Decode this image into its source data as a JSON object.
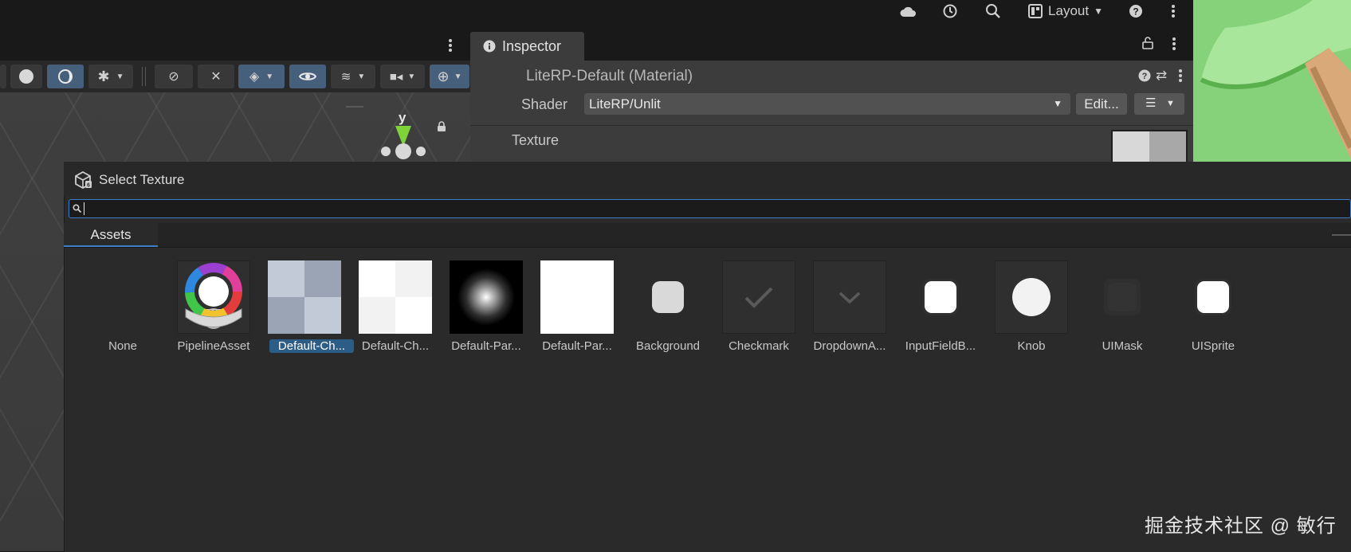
{
  "topbar": {
    "layout_label": "Layout",
    "icons": [
      "cloud-icon",
      "history-icon",
      "search-icon",
      "layout-icon",
      "help-icon",
      "more-icon"
    ]
  },
  "scene": {
    "axis_label": "y"
  },
  "inspector": {
    "tab_label": "Inspector",
    "material_title": "LiteRP-Default (Material)",
    "shader_label": "Shader",
    "shader_value": "LiteRP/Unlit",
    "edit_label": "Edit...",
    "texture_label": "Texture"
  },
  "dialog": {
    "title": "Select Texture",
    "search_value": "",
    "tab_assets": "Assets",
    "items": [
      {
        "label": "None"
      },
      {
        "label": "PipelineAsset"
      },
      {
        "label": "Default-Ch..."
      },
      {
        "label": "Default-Ch..."
      },
      {
        "label": "Default-Par..."
      },
      {
        "label": "Default-Par..."
      },
      {
        "label": "Background"
      },
      {
        "label": "Checkmark"
      },
      {
        "label": "DropdownA..."
      },
      {
        "label": "InputFieldB..."
      },
      {
        "label": "Knob"
      },
      {
        "label": "UIMask"
      },
      {
        "label": "UISprite"
      }
    ],
    "selected_index": 2
  },
  "watermark": "掘金技术社区 @ 敏行",
  "colors": {
    "accent": "#3c7cc8",
    "selection": "#2c5d87",
    "toolbar_active": "#46607c",
    "game_green": "#86d27a"
  }
}
